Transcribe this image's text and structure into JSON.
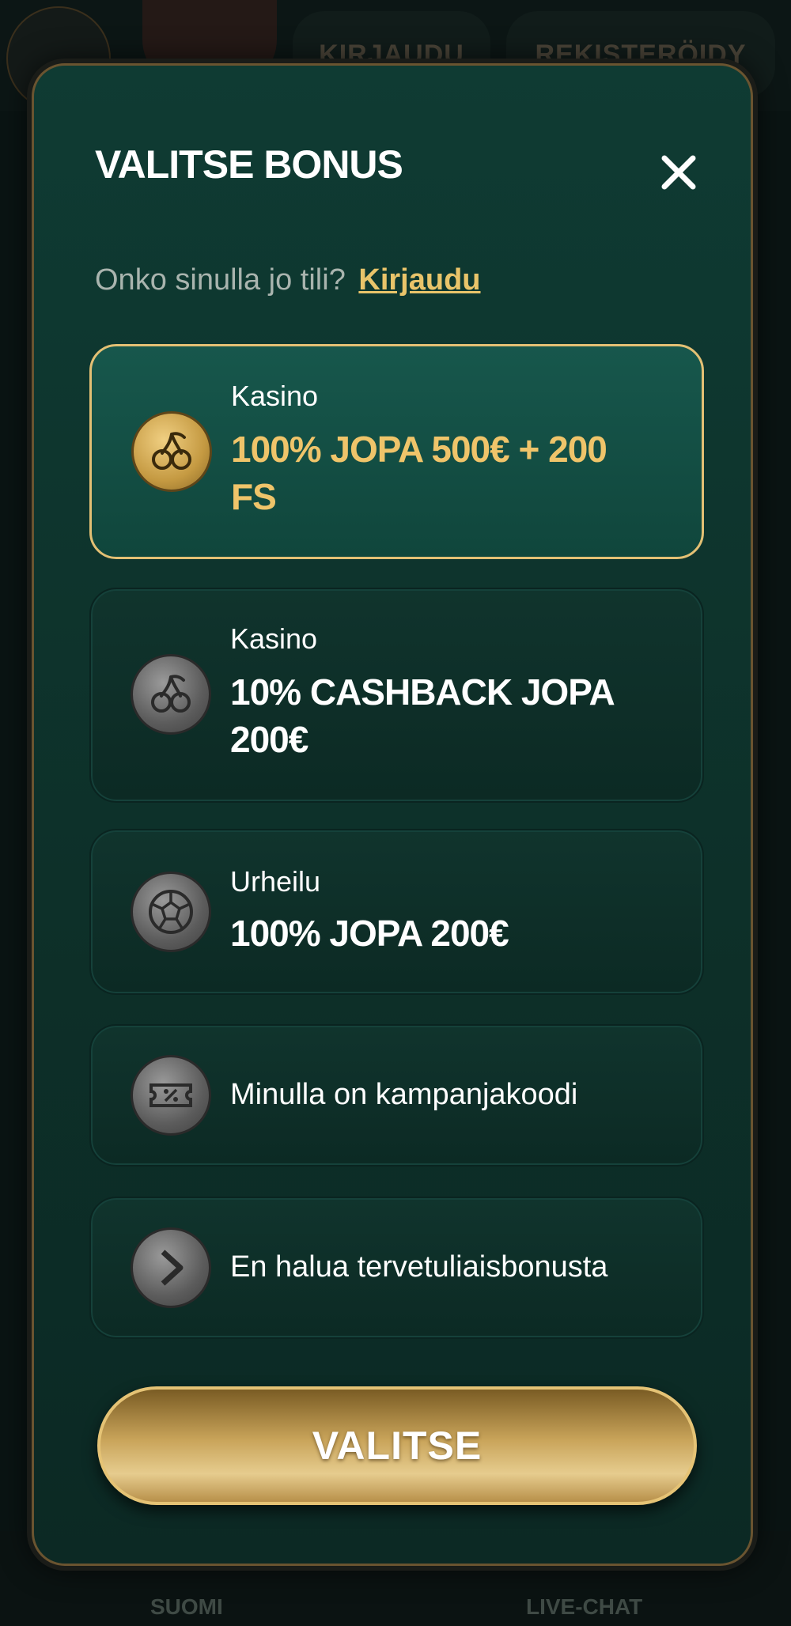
{
  "background": {
    "login_label": "KIRJAUDU",
    "register_label": "REKISTERÖIDY",
    "footer_language": "SUOMI",
    "footer_chat": "LIVE-CHAT"
  },
  "modal": {
    "title": "VALITSE BONUS",
    "close_icon": "close-icon",
    "subtitle_text": "Onko sinulla jo tili?",
    "subtitle_link": "Kirjaudu",
    "options": [
      {
        "category": "Kasino",
        "title": "100% JOPA 500€ + 200 FS",
        "icon": "cherries-icon",
        "selected": true
      },
      {
        "category": "Kasino",
        "title": "10% CASHBACK JOPA 200€",
        "icon": "cherries-icon",
        "selected": false
      },
      {
        "category": "Urheilu",
        "title": "100% JOPA 200€",
        "icon": "soccer-ball-icon",
        "selected": false
      },
      {
        "text": "Minulla on kampanjakoodi",
        "icon": "ticket-percent-icon",
        "selected": false
      },
      {
        "text": "En halua tervetuliaisbonusta",
        "icon": "chevron-right-icon",
        "selected": false
      }
    ],
    "submit_label": "VALITSE"
  },
  "colors": {
    "accent_gold": "#efc46a",
    "modal_bg": "#0f3b33",
    "selected_border": "#e3c074"
  }
}
